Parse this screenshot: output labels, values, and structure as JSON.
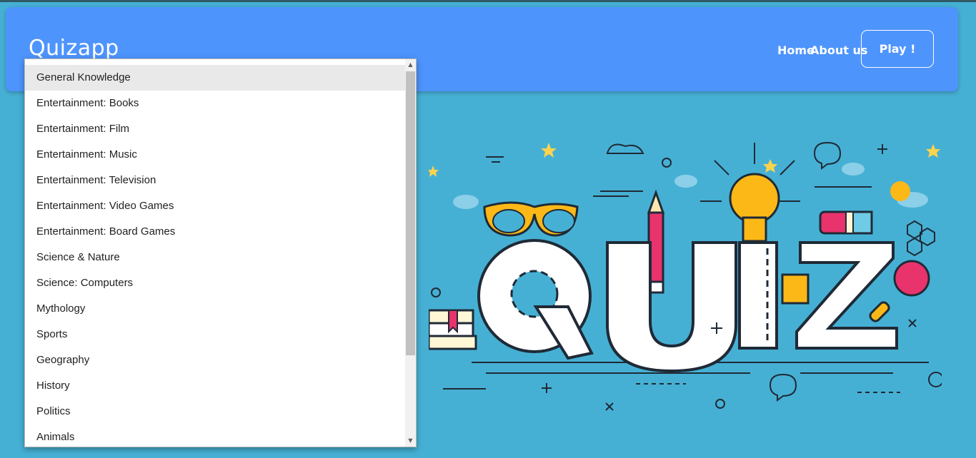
{
  "brand": "Quizapp",
  "nav": {
    "home": "Home",
    "about": "About us",
    "play": "Play !"
  },
  "dropdown": {
    "selected": "General Knowledge",
    "options": [
      "General Knowledge",
      "Entertainment: Books",
      "Entertainment: Film",
      "Entertainment: Music",
      "Entertainment: Television",
      "Entertainment: Video Games",
      "Entertainment: Board Games",
      "Science & Nature",
      "Science: Computers",
      "Mythology",
      "Sports",
      "Geography",
      "History",
      "Politics",
      "Animals"
    ]
  },
  "colors": {
    "background": "#46b0d4",
    "navbar": "#4e94fd",
    "quiz_pink": "#e8336d",
    "quiz_yellow": "#fbb817"
  },
  "icons": {
    "scroll_up": "triangle-up-icon",
    "scroll_down": "triangle-down-icon"
  }
}
